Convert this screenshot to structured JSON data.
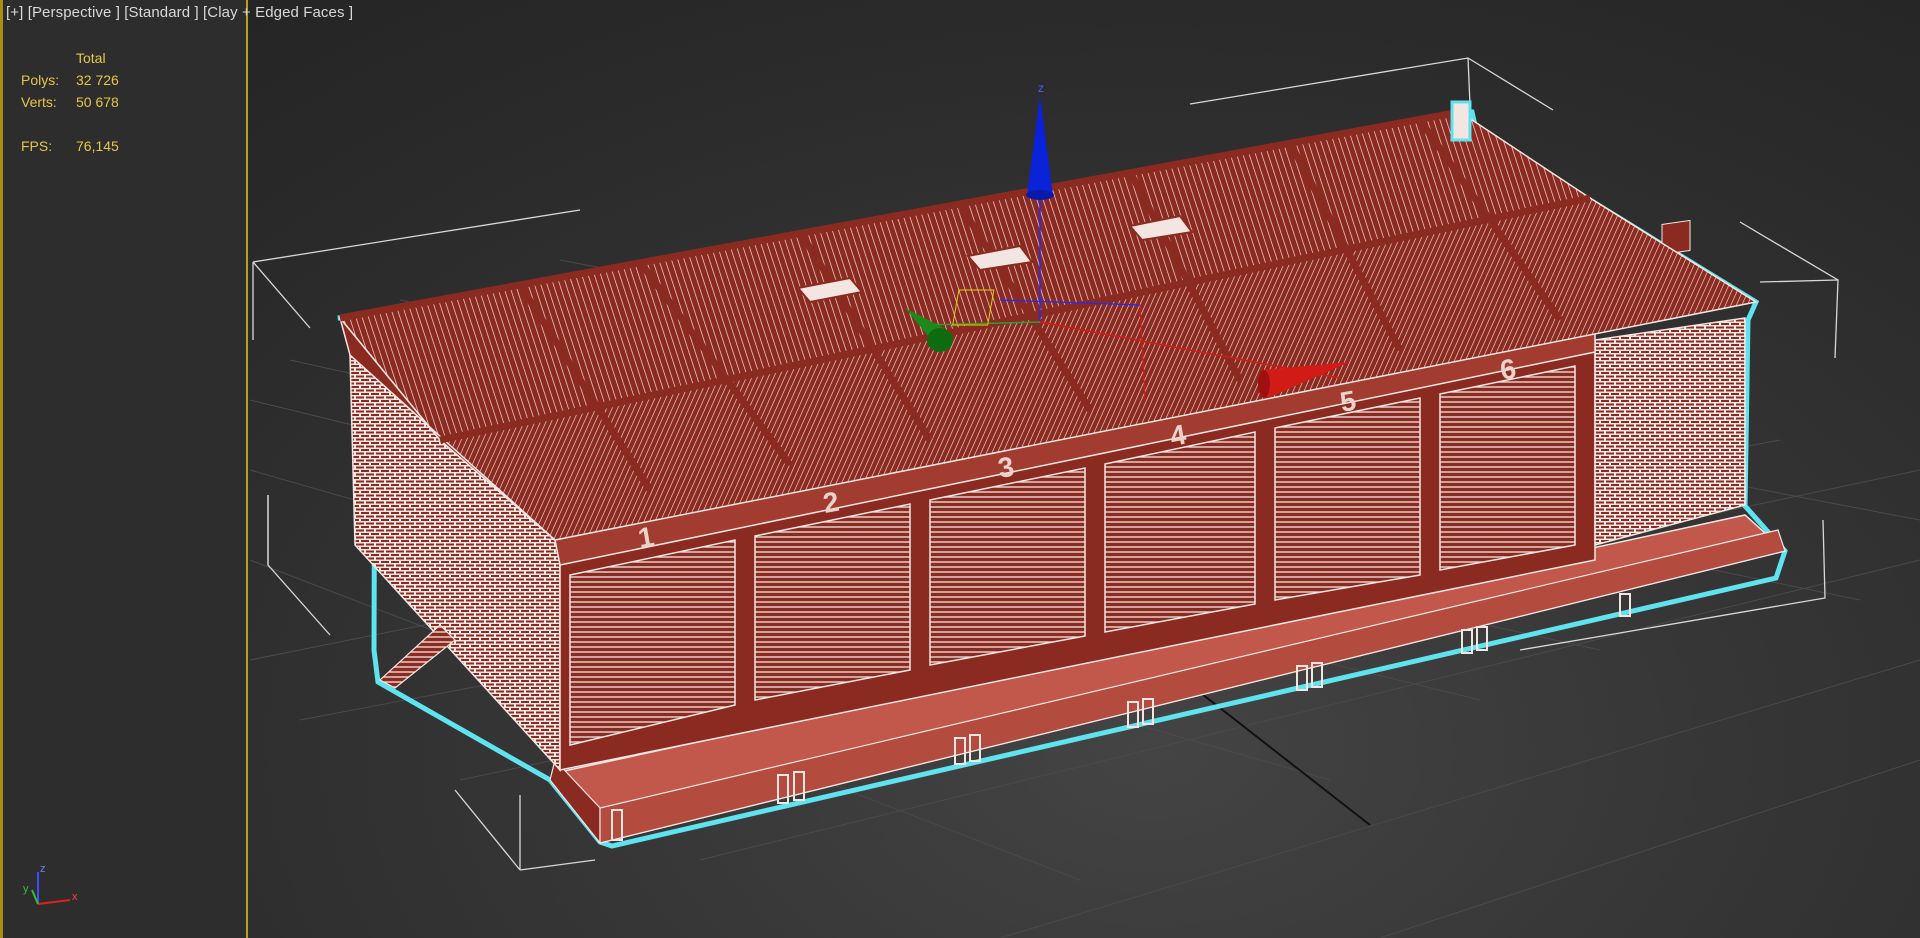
{
  "viewport": {
    "labels": [
      "[+]",
      "[Perspective ]",
      "[Standard ]",
      "[Clay + Edged Faces ]"
    ]
  },
  "stats": {
    "header": "Total",
    "polys_label": "Polys:",
    "polys_value": "32 726",
    "verts_label": "Verts:",
    "verts_value": "50 678",
    "fps_label": "FPS:",
    "fps_value": "76,145"
  },
  "model": {
    "bay_numbers": [
      "1",
      "2",
      "3",
      "4",
      "5",
      "6"
    ],
    "wire_color": "#8b2a20",
    "wire_edge_color": "#f3e6e2",
    "selection_color": "#5fe3ee"
  },
  "gizmo": {
    "z_color": "#0a22d8",
    "y_color": "#0f6b10",
    "x_color": "#d21b16",
    "z_label": "z"
  },
  "tripod": {
    "x_label": "x",
    "y_label": "y",
    "z_label": "z"
  }
}
